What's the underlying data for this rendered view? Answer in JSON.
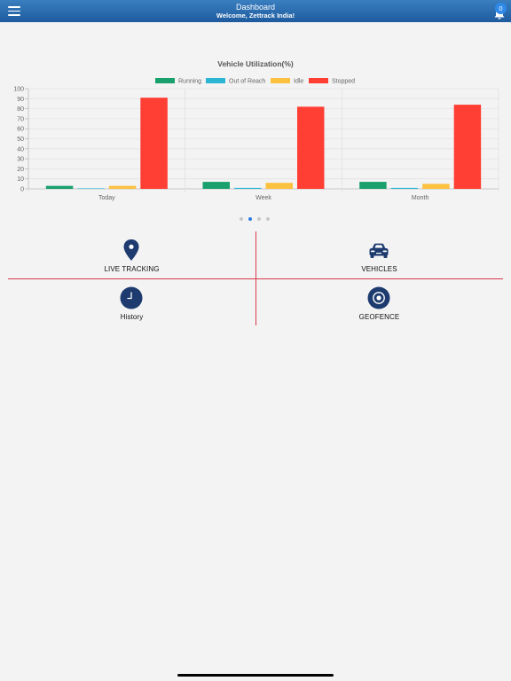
{
  "header": {
    "title": "Dashboard",
    "subtitle": "Welcome, Zettrack India!",
    "notification_count": "0"
  },
  "chart_data": {
    "type": "bar",
    "title": "Vehicle Utilization(%)",
    "categories": [
      "Today",
      "Week",
      "Month"
    ],
    "series": [
      {
        "name": "Running",
        "color": "#1aa06d",
        "values": [
          3,
          7,
          7
        ]
      },
      {
        "name": "Out of Reach",
        "color": "#2bb6d4",
        "values": [
          0,
          1,
          1
        ]
      },
      {
        "name": "Idle",
        "color": "#fbc13f",
        "values": [
          3,
          6,
          5
        ]
      },
      {
        "name": "Stopped",
        "color": "#ff3f33",
        "values": [
          91,
          82,
          84
        ]
      }
    ],
    "ylim": [
      0,
      100
    ],
    "yticks": [
      "0",
      "10",
      "20",
      "30",
      "40",
      "50",
      "60",
      "70",
      "80",
      "90",
      "100"
    ],
    "grid": true,
    "legend": "top-center"
  },
  "pager": {
    "count": 4,
    "active": 1
  },
  "tiles": [
    {
      "label": "LIVE TRACKING",
      "icon": "map-pin-icon"
    },
    {
      "label": "VEHICLES",
      "icon": "car-icon"
    },
    {
      "label": "History",
      "icon": "clock-icon"
    },
    {
      "label": "GEOFENCE",
      "icon": "target-icon"
    }
  ],
  "colors": {
    "header": "#2c6fb2",
    "icon": "#1d3b6e",
    "divider": "#d63a4d",
    "pager_active": "#2a7de1"
  }
}
